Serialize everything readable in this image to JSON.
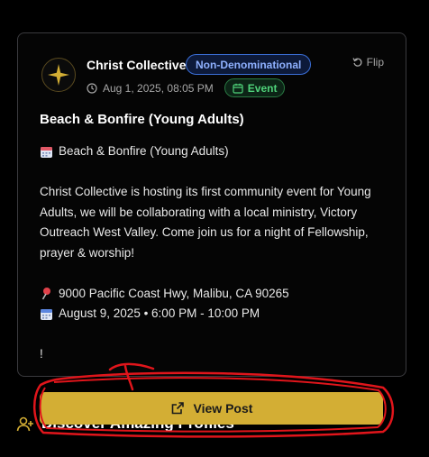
{
  "post": {
    "org_name": "Christ Collective",
    "denomination": "Non-Denominational",
    "flip_label": "Flip",
    "timestamp": "Aug 1, 2025, 08:05 PM",
    "type_badge": "Event",
    "title": "Beach & Bonfire (Young Adults)",
    "body_title_line": "Beach & Bonfire (Young Adults)",
    "body_paragraph": "Christ Collective is hosting its first community event for Young Adults, we will be collaborating with a local ministry, Victory Outreach West Valley. Come join us for a night of Fellowship, prayer & worship!",
    "location": "9000 Pacific Coast Hwy, Malibu, CA 90265",
    "date_time": "August 9, 2025 • 6:00 PM - 10:00 PM",
    "trailing": "!"
  },
  "actions": {
    "view_post_label": "View Post"
  },
  "section": {
    "discover_title": "Discover Amazing Profiles"
  },
  "icons": {
    "avatar": "star-logo-icon",
    "flip": "rotate-icon",
    "timestamp": "clock-icon",
    "event": "calendar-icon",
    "location": "pin-icon",
    "view_post": "external-link-icon",
    "discover": "user-plus-icon"
  },
  "colors": {
    "accent_gold": "#d3ae34",
    "denomination_badge": "#8fb1ff",
    "event_badge": "#4fd27a",
    "annotation_red": "#e0151b"
  }
}
